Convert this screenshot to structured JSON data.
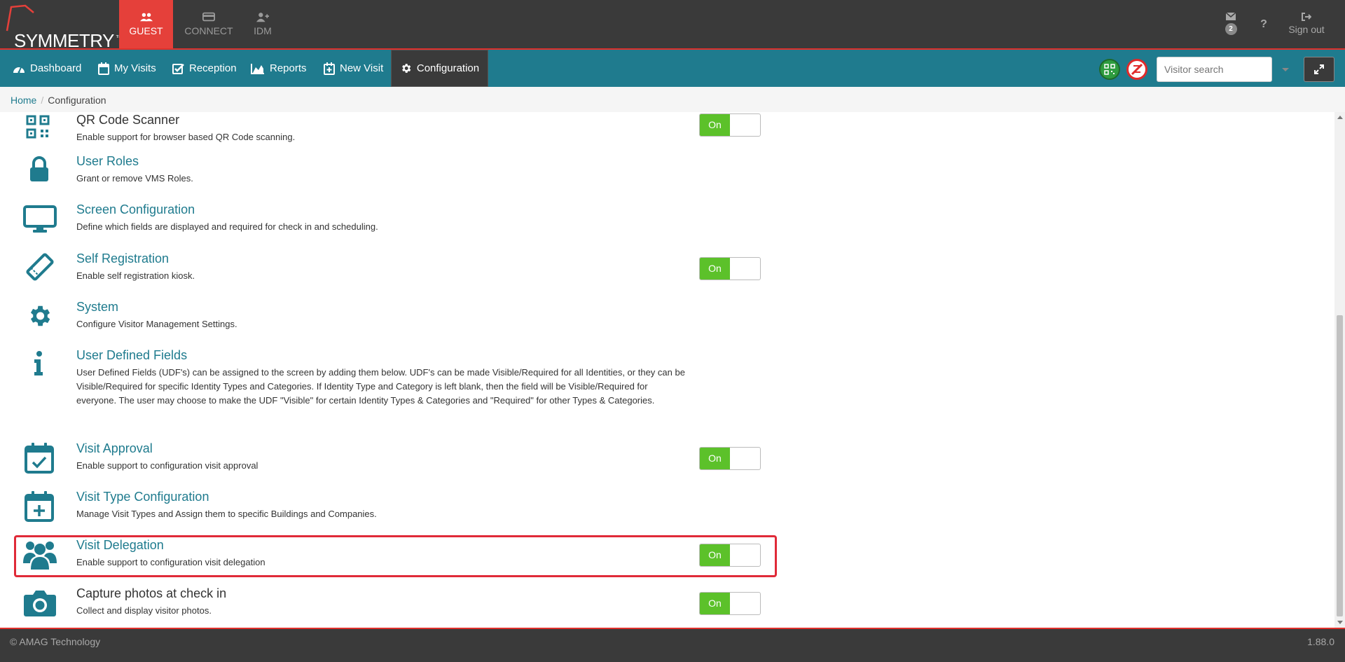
{
  "brand": {
    "name": "SYMMETRY",
    "tm": "™"
  },
  "app_tabs": [
    {
      "label": "GUEST",
      "icon": "users-icon",
      "active": true
    },
    {
      "label": "CONNECT",
      "icon": "card-icon",
      "active": false
    },
    {
      "label": "IDM",
      "icon": "user-plus-icon",
      "active": false
    }
  ],
  "header_right": {
    "mail_count": "2",
    "help": "?",
    "signout_label": "Sign out"
  },
  "nav": {
    "dashboard": "Dashboard",
    "my_visits": "My Visits",
    "reception": "Reception",
    "reports": "Reports",
    "new_visit": "New Visit",
    "configuration": "Configuration"
  },
  "search": {
    "placeholder": "Visitor search"
  },
  "breadcrumb": {
    "home": "Home",
    "separator": "/",
    "current": "Configuration"
  },
  "items": [
    {
      "title": "QR Code Scanner",
      "desc": "Enable support for browser based QR Code scanning.",
      "toggle": "On",
      "icon": "qr-code-icon"
    },
    {
      "title": "User Roles",
      "desc": "Grant or remove VMS Roles.",
      "icon": "lock-icon"
    },
    {
      "title": "Screen Configuration",
      "desc": "Define which fields are displayed and required for check in and scheduling.",
      "icon": "monitor-icon"
    },
    {
      "title": "Self Registration",
      "desc": "Enable self registration kiosk.",
      "toggle": "On",
      "icon": "ticket-icon"
    },
    {
      "title": "System",
      "desc": "Configure Visitor Management Settings.",
      "icon": "gear-icon"
    },
    {
      "title": "User Defined Fields",
      "desc": "User Defined Fields (UDF's) can be assigned to the screen by adding them below. UDF's can be made Visible/Required for all Identities, or they can be Visible/Required for specific Identity Types and Categories. If Identity Type and Category is left blank, then the field will be Visible/Required for everyone. The user may choose to make the UDF \"Visible\" for certain Identity Types & Categories and \"Required\" for other Types & Categories.",
      "icon": "info-icon"
    },
    {
      "title": "Visit Approval",
      "desc": "Enable support to configuration visit approval",
      "toggle": "On",
      "icon": "calendar-check-icon"
    },
    {
      "title": "Visit Type Configuration",
      "desc": "Manage Visit Types and Assign them to specific Buildings and Companies.",
      "icon": "calendar-plus-icon"
    },
    {
      "title": "Visit Delegation",
      "desc": "Enable support to configuration visit delegation",
      "toggle": "On",
      "icon": "users-icon"
    },
    {
      "title": "Capture photos at check in",
      "desc": "Collect and display visitor photos.",
      "toggle": "On",
      "icon": "camera-icon"
    }
  ],
  "footer": {
    "copyright": "© AMAG Technology",
    "version": "1.88.0"
  },
  "colors": {
    "teal": "#1f7b8e",
    "red": "#e5403a",
    "dark": "#3a3a3a",
    "green": "#5cc12a"
  }
}
